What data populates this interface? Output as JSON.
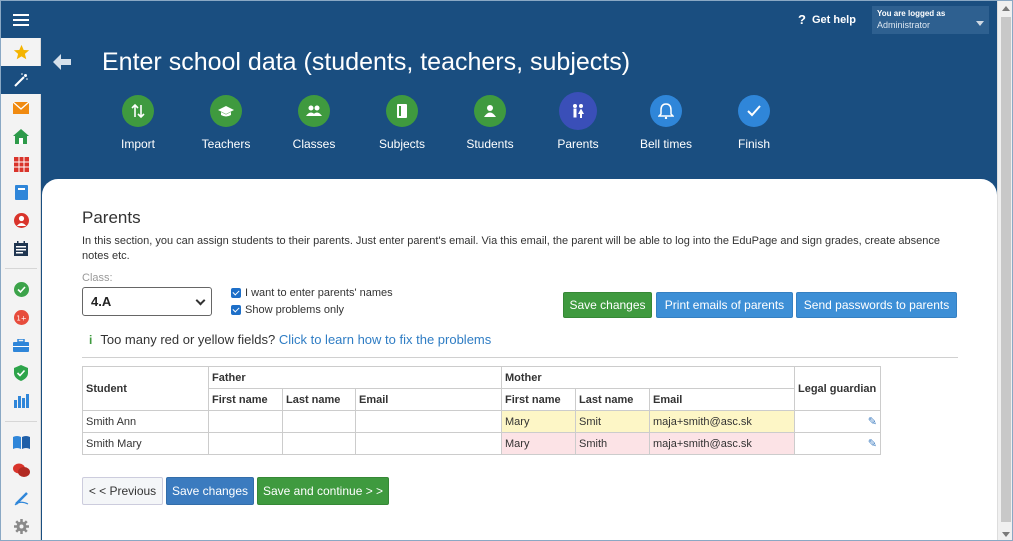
{
  "topbar": {
    "help_label": "Get help",
    "user_line1": "You are logged as",
    "user_line2": "Administrator"
  },
  "header": {
    "title": "Enter school data (students, teachers, subjects)",
    "steps": [
      {
        "label": "Import",
        "icon": "import-icon",
        "color": "#3f9a3f"
      },
      {
        "label": "Teachers",
        "icon": "graduation-cap-icon",
        "color": "#3f9a3f"
      },
      {
        "label": "Classes",
        "icon": "group-icon",
        "color": "#3f9a3f"
      },
      {
        "label": "Subjects",
        "icon": "book-icon",
        "color": "#3f9a3f"
      },
      {
        "label": "Students",
        "icon": "person-icon",
        "color": "#3f9a3f"
      },
      {
        "label": "Parents",
        "icon": "parents-icon",
        "color": "#3a4fb8"
      },
      {
        "label": "Bell times",
        "icon": "bell-icon",
        "color": "#2f86d9"
      },
      {
        "label": "Finish",
        "icon": "check-icon",
        "color": "#2f86d9"
      }
    ]
  },
  "section": {
    "title": "Parents",
    "description": "In this section, you can assign students to their parents. Just enter parent's email. Via this email, the parent will be able to log into the EduPage and sign grades, create absence notes etc.",
    "class_label": "Class:",
    "class_value": "4.A",
    "check1": "I want to enter parents' names",
    "check2": "Show problems only"
  },
  "buttons": {
    "save_changes": "Save changes",
    "print_emails": "Print emails of parents",
    "send_passwords": "Send passwords to parents",
    "previous": "< < Previous",
    "save_bottom": "Save changes",
    "save_continue": "Save and continue > >"
  },
  "info": {
    "text": "Too many red or yellow fields?",
    "link": "Click to learn how to fix the problems"
  },
  "table": {
    "student": "Student",
    "father": "Father",
    "mother": "Mother",
    "legal": "Legal guardian",
    "first_name": "First name",
    "last_name": "Last name",
    "email": "Email",
    "rows": [
      {
        "student": "Smith Ann",
        "m_first": "Mary",
        "m_last": "Smit",
        "m_email": "maja+smith@asc.sk"
      },
      {
        "student": "Smith Mary",
        "m_first": "Mary",
        "m_last": "Smith",
        "m_email": "maja+smith@asc.sk"
      }
    ]
  },
  "colors": {
    "brand": "#1a4e80",
    "green": "#3f9a3f",
    "blue": "#3d8fd6",
    "warn_yellow": "#fdf6c6",
    "warn_red": "#fce3e6"
  }
}
